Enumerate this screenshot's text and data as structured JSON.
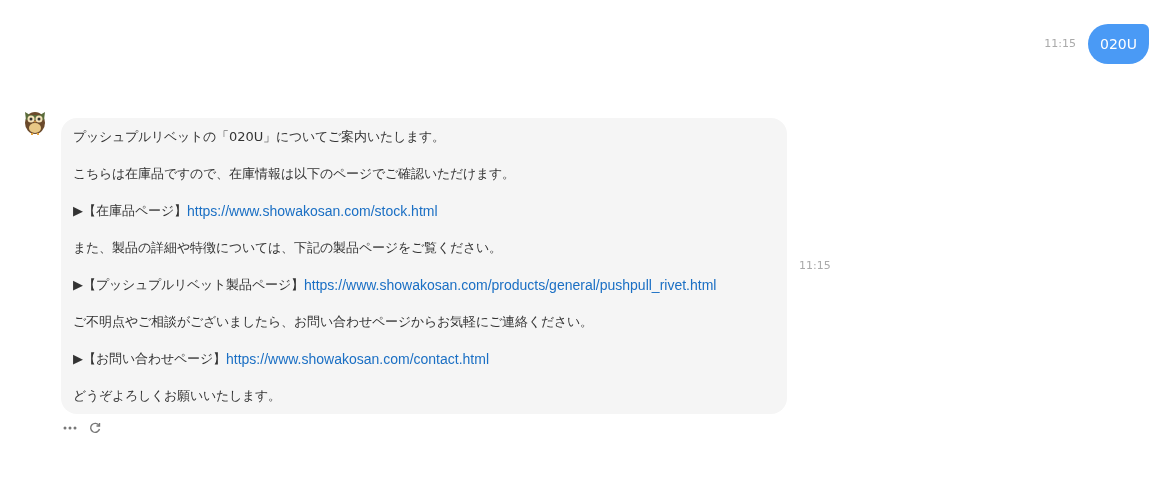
{
  "user_message": {
    "time": "11:15",
    "text": "020U"
  },
  "bot_message": {
    "time": "11:15",
    "paragraphs": [
      {
        "kind": "text",
        "text": "プッシュプルリベットの「020U」についてご案内いたします。"
      },
      {
        "kind": "text",
        "text": "こちらは在庫品ですので、在庫情報は以下のページでご確認いただけます。"
      },
      {
        "kind": "link",
        "prefix": "▶【在庫品ページ】",
        "url": "https://www.showakosan.com/stock.html"
      },
      {
        "kind": "text",
        "text": "また、製品の詳細や特徴については、下記の製品ページをご覧ください。"
      },
      {
        "kind": "link",
        "prefix": "▶【プッシュプルリベット製品ページ】",
        "url": "https://www.showakosan.com/products/general/pushpull_rivet.html"
      },
      {
        "kind": "text",
        "text": "ご不明点やご相談がございましたら、お問い合わせページからお気軽にご連絡ください。"
      },
      {
        "kind": "link",
        "prefix": "▶【お問い合わせページ】",
        "url": "https://www.showakosan.com/contact.html"
      },
      {
        "kind": "text",
        "text": "どうぞよろしくお願いいたします。"
      }
    ]
  }
}
